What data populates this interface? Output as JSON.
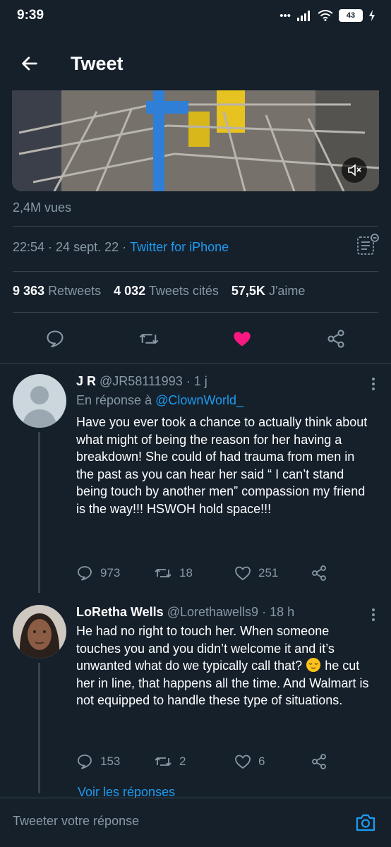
{
  "status_bar": {
    "time": "9:39",
    "battery": "43"
  },
  "header": {
    "title": "Tweet"
  },
  "tweet": {
    "views": "2,4M vues",
    "time": "22:54",
    "date": "24 sept. 22",
    "source": "Twitter for iPhone",
    "retweets_count": "9 363",
    "retweets_label": "Retweets",
    "quotes_count": "4 032",
    "quotes_label": "Tweets cités",
    "likes_count": "57,5K",
    "likes_label": "J'aime",
    "like_color": "#f91880"
  },
  "replies": [
    {
      "name": "J R",
      "handle": "@JR58111993",
      "age": "1 j",
      "in_reply_prefix": "En réponse à",
      "in_reply_handle": "@ClownWorld_",
      "text": "Have you ever took a chance to actually think about what might of being the reason for her having a breakdown! She could of had trauma from men in the past as you can hear her said “ I can’t stand being touch by another men” compassion my friend is the way!!! HSWOH hold space!!!",
      "replies": "973",
      "retweets": "18",
      "likes": "251"
    },
    {
      "name": "LoRetha Wells",
      "handle": "@Lorethawells9",
      "age": "18 h",
      "text_before_emoji": "He had no right to touch her. When someone touches you and you didn’t welcome it and it’s unwanted what do we typically call that? ",
      "text_after_emoji": " he cut her in line, that happens all the time. And Walmart is not equipped to handle these type of situations.",
      "replies": "153",
      "retweets": "2",
      "likes": "6"
    }
  ],
  "see_replies": "Voir les réponses",
  "compose": {
    "placeholder": "Tweeter votre réponse"
  },
  "colors": {
    "background": "#15202b",
    "accent": "#1d9bf0",
    "muted": "#8899a6",
    "divider": "#38444d"
  }
}
